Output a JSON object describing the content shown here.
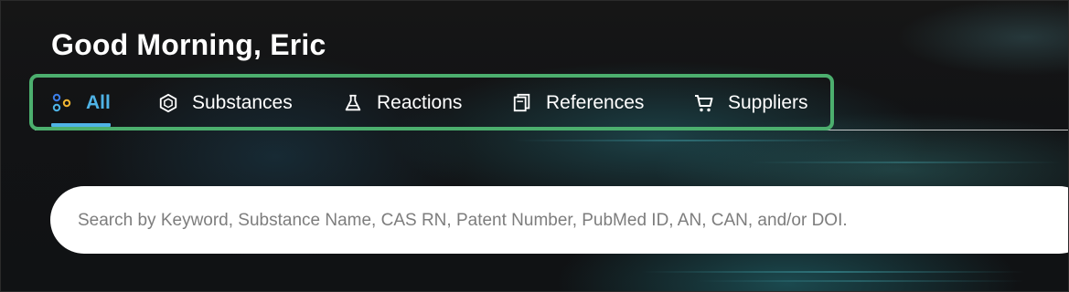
{
  "greeting": "Good Morning, Eric",
  "tabs": [
    {
      "label": "All",
      "icon": "molecule-nodes-icon",
      "active": true
    },
    {
      "label": "Substances",
      "icon": "hexagon-icon",
      "active": false
    },
    {
      "label": "Reactions",
      "icon": "flask-icon",
      "active": false
    },
    {
      "label": "References",
      "icon": "document-icon",
      "active": false
    },
    {
      "label": "Suppliers",
      "icon": "cart-icon",
      "active": false
    }
  ],
  "search": {
    "placeholder": "Search by Keyword, Substance Name, CAS RN, Patent Number, PubMed ID, AN, CAN, and/or DOI."
  },
  "colors": {
    "accent": "#4fb3e6",
    "highlight_box": "#4caf6e",
    "background": "#121315"
  }
}
